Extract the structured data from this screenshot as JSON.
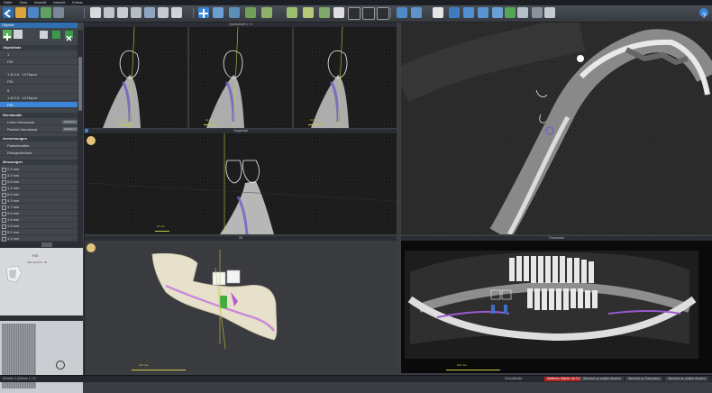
{
  "app": {
    "menu": [
      "Datei",
      "Visio",
      "Ansicht",
      "Ansicht",
      "Extras"
    ]
  },
  "toolbar": {
    "icons": [
      "back-icon",
      "open-folder-icon",
      "save-icon",
      "export-icon",
      "print-icon",
      "tooth-icon",
      "implant-icon",
      "crown-icon",
      "nerve-icon",
      "measure-icon",
      "ruler-icon",
      "undo-icon",
      "redo-icon",
      "cross-icon",
      "window-icon",
      "zoom-icon",
      "pan-icon",
      "rotate-icon",
      "screenshot-icon",
      "download-icon",
      "tooth-outline-icon",
      "arrow-icon",
      "layout-icon",
      "print-icon",
      "surgical-guide-icon",
      "help-icon"
    ]
  },
  "left_panel": {
    "header": "Objekte",
    "sections": {
      "objects": "Objektliste",
      "implant_group_1": [
        "1",
        "FDI"
      ],
      "implant_group_2": [
        "1 Ø 4.5 · 10 Rapid",
        "FDI"
      ],
      "implant_group_3": [
        "5",
        "1 Ø 4.5 · 10 Rapid",
        "FDI"
      ],
      "nerves_title": "Nervkanäle",
      "nerves": [
        {
          "label": "Linker Nervkanal",
          "btn": "Entfernen"
        },
        {
          "label": "Rechter Nervkanal",
          "btn": "Entfernen"
        }
      ],
      "annotations_title": "Anmerkungen",
      "annotations": [
        "Patientenakte",
        "Röntgenbefund"
      ],
      "measurements_title": "Messungen",
      "measurements": [
        "2.5 mm",
        "3.0 mm",
        "5.6 mm",
        "1.2 mm",
        "8.6 mm",
        "4.3 mm",
        "1.7 mm",
        "9.6 mm",
        "1.6 mm",
        "1.8 mm",
        "5.0 mm",
        "1.4 mm"
      ]
    },
    "preview": {
      "title": "FDI",
      "subtitle": "Zahnposition: 36"
    }
  },
  "viewports": {
    "cross_sections": "Querschnitt 1 / 3",
    "cross_mm": [
      "10 mm",
      "10 mm",
      "10 mm"
    ],
    "tangential": "Tangential",
    "tangential_mm": "10 mm",
    "axial": "",
    "render3d": "3D",
    "render3d_mm": "100 mm",
    "panorama": "Panorama",
    "panorama_mm": "100 mm"
  },
  "status": {
    "left": "Schicht: 1 (Ebene 1 / 2)",
    "mid": "Schnittbreite",
    "red": "Weiteres Objekt: ab 0.0",
    "boxes": [
      "Wechsel zu axialer Ansicht",
      "Wechsel zu Panorama",
      "Wechsel zu axialer Ansicht"
    ]
  },
  "colors": {
    "accent": "#3c85d6",
    "scale": "#c8c84b",
    "nerve": "#9b59d0",
    "implant": "#3fae3f"
  }
}
